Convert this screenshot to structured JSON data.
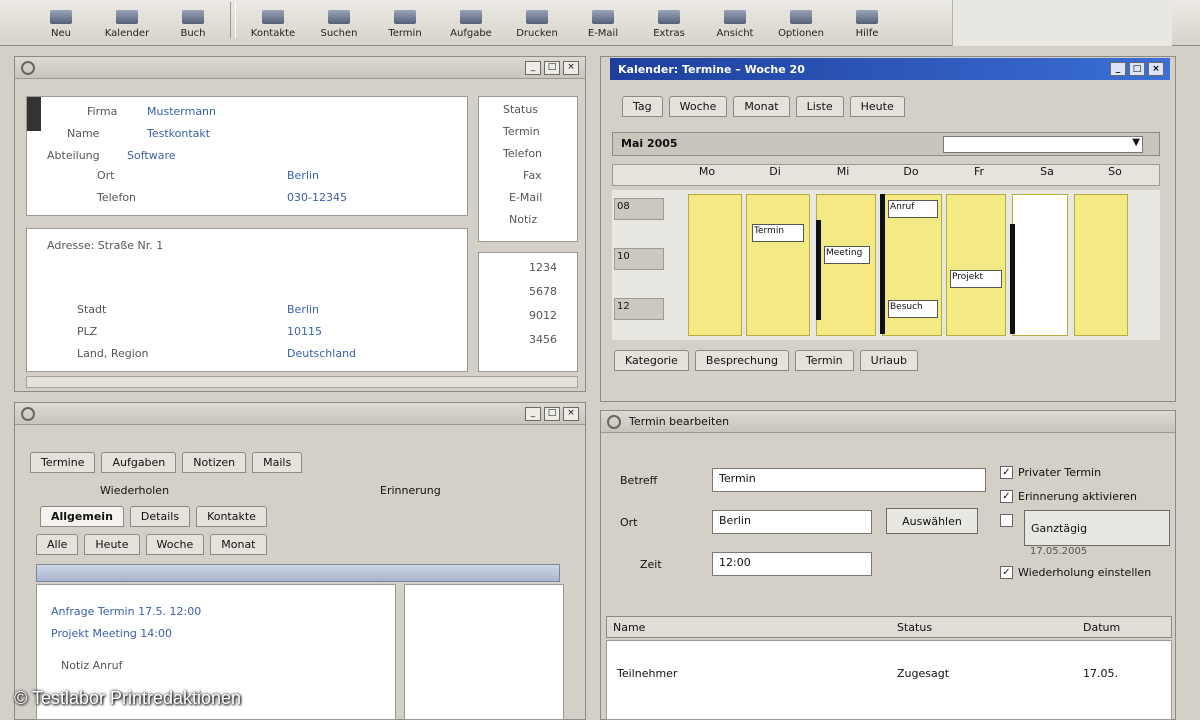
{
  "toolbar": {
    "buttons": [
      {
        "label": "Neu",
        "icon": "new-icon"
      },
      {
        "label": "Kalender",
        "icon": "calendar-icon"
      },
      {
        "label": "Buch",
        "icon": "book-icon"
      },
      {
        "label": "Kontakte",
        "icon": "contacts-icon"
      },
      {
        "label": "Suchen",
        "icon": "search-icon"
      },
      {
        "label": "Termin",
        "icon": "appointment-icon"
      },
      {
        "label": "Aufgabe",
        "icon": "task-icon"
      },
      {
        "label": "Drucken",
        "icon": "print-icon"
      },
      {
        "label": "E-Mail",
        "icon": "mail-icon"
      },
      {
        "label": "Extras",
        "icon": "tools-icon"
      },
      {
        "label": "Ansicht",
        "icon": "view-icon"
      },
      {
        "label": "Optionen",
        "icon": "options-icon"
      },
      {
        "label": "Hilfe",
        "icon": "help-icon"
      }
    ]
  },
  "details_panel": {
    "fields": [
      {
        "label": "Firma",
        "value": "Mustermann"
      },
      {
        "label": "Name",
        "value": "Testkontakt"
      },
      {
        "label": "Abteilung",
        "value": "Software"
      },
      {
        "label": "Ort",
        "value": "Berlin"
      },
      {
        "label": "Telefon",
        "value": "030-12345"
      }
    ],
    "side_labels": [
      "Status",
      "Termin",
      "Telefon",
      "Fax",
      "E-Mail",
      "Notiz"
    ],
    "section_title": "Adresse: Straße Nr. 1",
    "rows": [
      {
        "label": "Stadt",
        "value": "Berlin"
      },
      {
        "label": "PLZ",
        "value": "10115"
      },
      {
        "label": "Land, Region",
        "value": "Deutschland"
      }
    ],
    "side_values": [
      "1234",
      "5678",
      "9012",
      "3456"
    ]
  },
  "task_panel": {
    "tabs": [
      "Termine",
      "Aufgaben",
      "Notizen",
      "Mails"
    ],
    "options": [
      "Wiederholen",
      "Erinnerung"
    ],
    "subtabs": [
      "Allgemein",
      "Details",
      "Kontakte"
    ],
    "filters": [
      "Alle",
      "Heute",
      "Woche",
      "Monat"
    ],
    "list": [
      "Anfrage  Termin 17.5.  12:00",
      "Projekt  Meeting  14:00",
      "Notiz  Anruf"
    ]
  },
  "calendar": {
    "window_title": "Kalender: Termine – Woche 20",
    "date_label": "Mai 2005",
    "toolbar_items": [
      "Tag",
      "Woche",
      "Monat",
      "Liste",
      "Heute"
    ],
    "days": [
      "Mo",
      "Di",
      "Mi",
      "Do",
      "Fr",
      "Sa",
      "So"
    ],
    "rows": [
      "08",
      "10",
      "12"
    ],
    "appointments": [
      "Termin",
      "Meeting",
      "Anruf",
      "Projekt",
      "Besuch"
    ],
    "footer_tabs": [
      "Kategorie",
      "Besprechung",
      "Termin",
      "Urlaub"
    ]
  },
  "edit_form": {
    "title": "Termin bearbeiten",
    "subject_label": "Betreff",
    "subject_value": "Termin",
    "location_label": "Ort",
    "location_value": "Berlin",
    "time_label": "Zeit",
    "time_value": "12:00",
    "select_button": "Auswählen",
    "checkboxes": [
      "Privater Termin",
      "Erinnerung aktivieren",
      "Ganztägig",
      "Wiederholung einstellen"
    ],
    "date_note": "17.05.2005",
    "table_headers": [
      "Name",
      "Status",
      "Datum"
    ],
    "table_row": [
      "Teilnehmer",
      "Zugesagt",
      "17.05."
    ]
  },
  "copyright": "© Testlabor Printredaktionen"
}
